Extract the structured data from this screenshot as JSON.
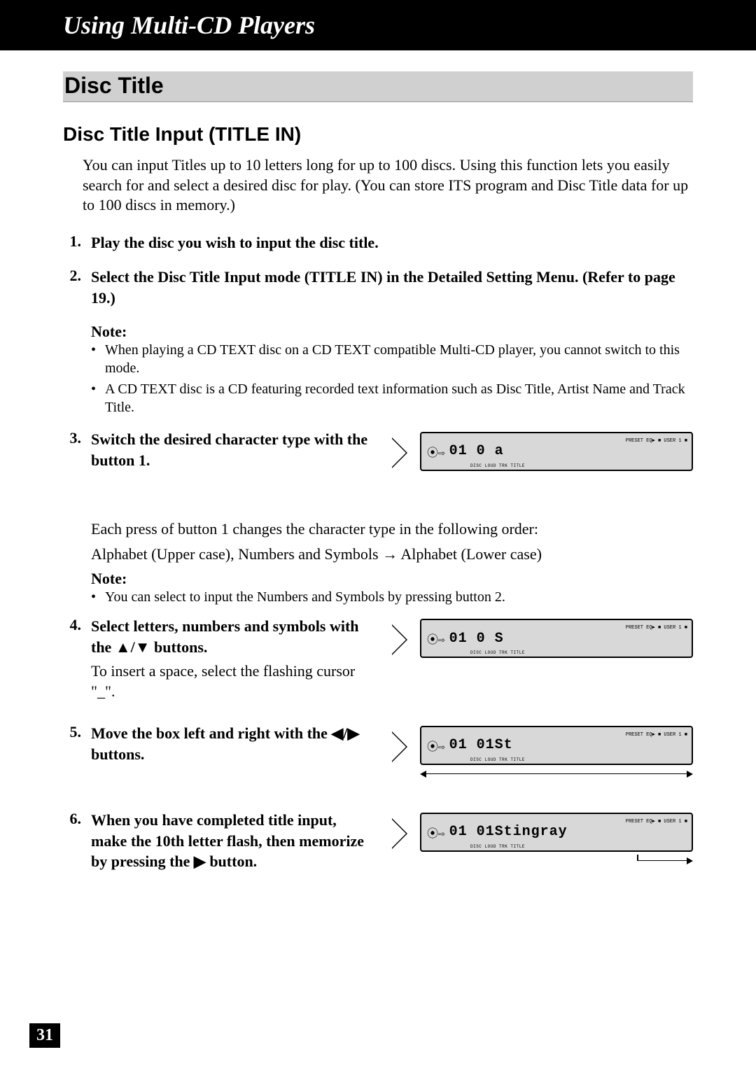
{
  "chapter": "Using Multi-CD Players",
  "h1": "Disc Title",
  "h2": "Disc Title Input (TITLE IN)",
  "intro": "You can input Titles up to 10 letters long for up to 100 discs. Using this function lets you easily search for and select a desired disc for play. (You can store ITS program and Disc Title data for up to 100 discs in memory.)",
  "steps": {
    "s1": {
      "n": "1.",
      "t": "Play the disc you wish to input the disc title."
    },
    "s2": {
      "n": "2.",
      "t": "Select the Disc Title Input mode (TITLE IN) in the Detailed Setting Menu. (Refer to page 19.)"
    },
    "note2_head": "Note:",
    "note2_b1": "When playing a CD TEXT disc on a CD TEXT compatible Multi-CD player, you cannot switch to this mode.",
    "note2_b2": "A CD TEXT disc is a CD featuring recorded text information such as Disc Title, Artist Name and Track Title.",
    "s3": {
      "n": "3.",
      "t": "Switch the desired character type with the button 1."
    },
    "p3a": "Each press of button 1 changes the character type in the following order:",
    "p3b_left": "Alphabet (Upper case), Numbers and Symbols ",
    "p3b_right": " Alphabet (Lower case)",
    "note3_head": "Note:",
    "note3_b1": "You can select to input the Numbers and Symbols by pressing button 2.",
    "s4": {
      "n": "4.",
      "t": "Select letters, numbers and symbols with the ▲/▼ buttons.",
      "sub": "To insert a space, select the flashing cursor \"_\"."
    },
    "s5": {
      "n": "5.",
      "t": "Move the box left and right with the ◀/▶ buttons."
    },
    "s6": {
      "n": "6.",
      "t": "When you have completed title input, make the 10th letter flash, then memorize by pressing the ▶ button."
    }
  },
  "lcd": {
    "d3": "01 0 a",
    "d4": "01 0 S",
    "d5": "01 01St",
    "d6": "01 01Stingray",
    "sub": "DISC  LOUD  TRK  TITLE",
    "right": "PRESET EQ▶ ■ USER 1 ■"
  },
  "arrow": "→",
  "page": "31"
}
